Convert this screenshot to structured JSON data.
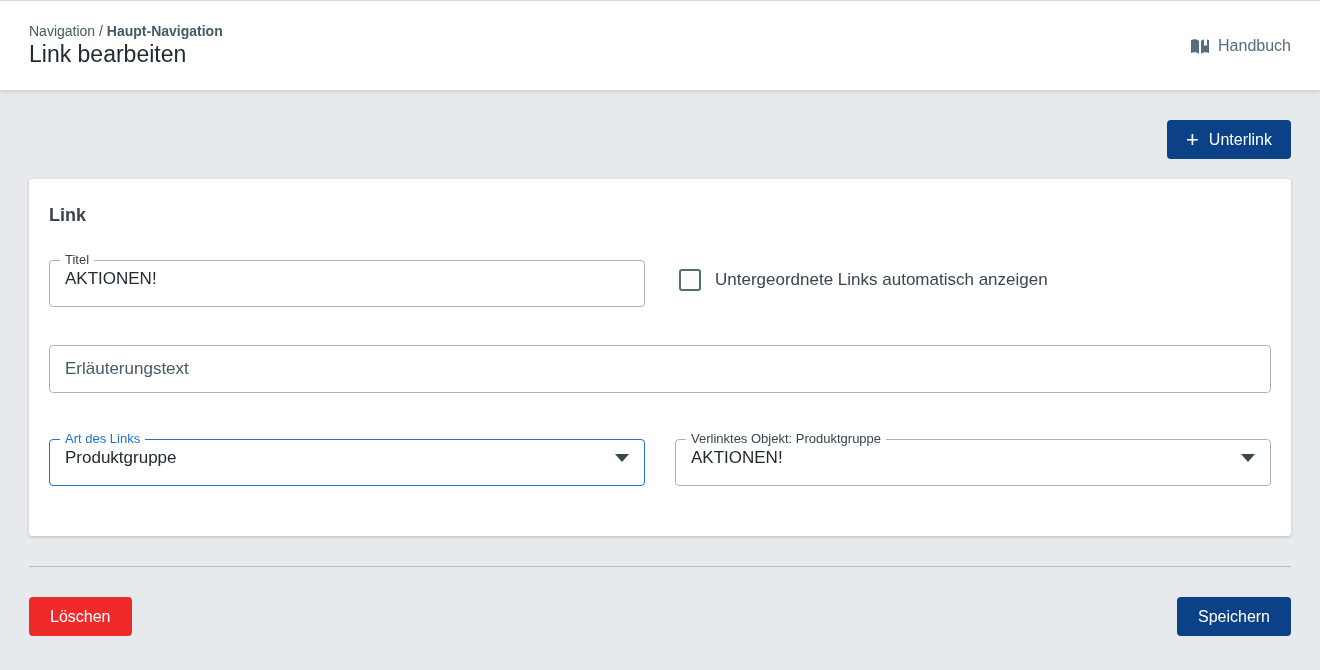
{
  "header": {
    "breadcrumb": {
      "parent": "Navigation",
      "separator": "/",
      "current": "Haupt-Navigation"
    },
    "title": "Link bearbeiten",
    "manual_link": "Handbuch"
  },
  "toolbar": {
    "add_button": {
      "icon": "+",
      "label": "Unterlink"
    }
  },
  "card": {
    "title": "Link",
    "title_field": {
      "kind": "text",
      "label": "Titel",
      "value": "AKTIONEN!",
      "focused": false
    },
    "auto_show_checkbox": {
      "label": "Untergeordnete Links automatisch anzeigen",
      "checked": false
    },
    "description_field": {
      "kind": "text",
      "placeholder": "Erläuterungstext",
      "focused": false
    },
    "link_type_field": {
      "kind": "select",
      "label": "Art des Links",
      "value": "Produktgruppe",
      "focused": true
    },
    "linked_object_field": {
      "kind": "select",
      "label": "Verlinktes Objekt: Produktgruppe",
      "value": "AKTIONEN!",
      "focused": false
    }
  },
  "footer": {
    "delete_button": "Löschen",
    "save_button": "Speichern"
  }
}
